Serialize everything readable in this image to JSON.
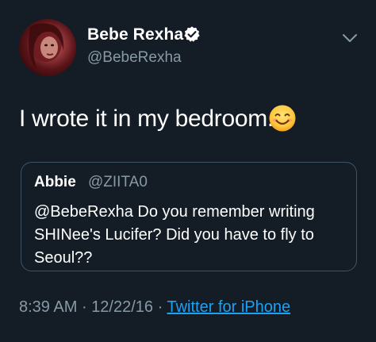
{
  "tweet": {
    "author": {
      "display_name": "Bebe Rexha",
      "handle": "@BebeRexha",
      "verified": true
    },
    "text": "I wrote it in my bedroom.",
    "emoji": "smiling-face-icon",
    "quoted": {
      "display_name": "Abbie",
      "handle": "@ZIITA0",
      "text": "@BebeRexha Do you remember writing\nSHINee's Lucifer? Did you have to fly to\nSeoul??"
    },
    "time": "8:39 AM",
    "date": "12/22/16",
    "separator": "·",
    "source": "Twitter for iPhone"
  },
  "colors": {
    "background": "#141d26",
    "secondary_text": "#8899a6",
    "link": "#1da1f2",
    "verified_badge": "#ffffff",
    "quote_border": "#3d5466"
  }
}
